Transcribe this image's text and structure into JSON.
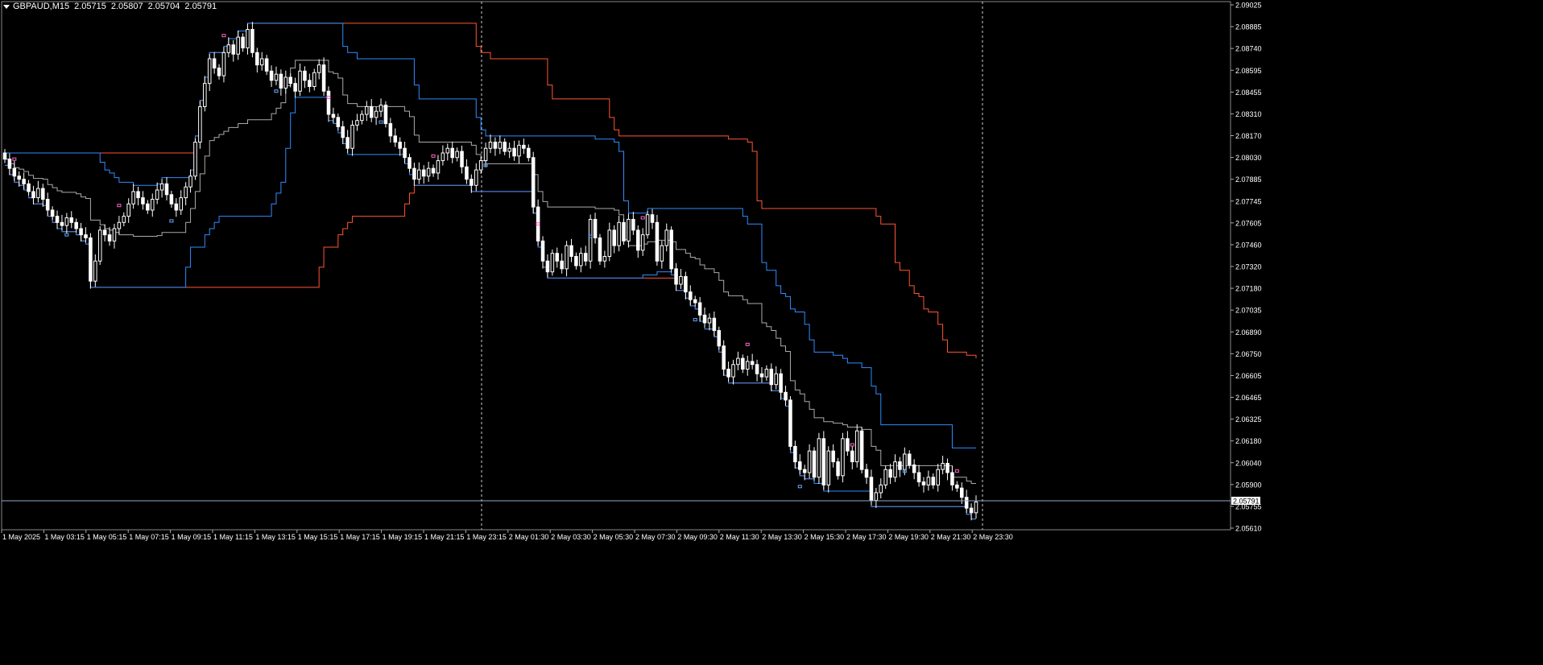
{
  "header": {
    "symbol": "GBPAUD,M15",
    "open": "2.05715",
    "high": "2.05807",
    "low": "2.05704",
    "close": "2.05791"
  },
  "current_price_label": "2.05791",
  "colors": {
    "background": "#000000",
    "candle": "#ffffff",
    "upper_band": "#ff5533",
    "middle_band": "#aaaaaa",
    "inner_band": "#2f8cff",
    "lower_band": "#ff5533",
    "marker_pink": "#ff66cc",
    "marker_blue": "#66aaff",
    "grid_vline": "#cccccc",
    "price_line": "#8fa8c8"
  },
  "y_axis_labels": [
    "2.09025",
    "2.08885",
    "2.08740",
    "2.08595",
    "2.08455",
    "2.08310",
    "2.08170",
    "2.08030",
    "2.07885",
    "2.07745",
    "2.07605",
    "2.07460",
    "2.07320",
    "2.07180",
    "2.07035",
    "2.06890",
    "2.06750",
    "2.06605",
    "2.06465",
    "2.06325",
    "2.06180",
    "2.06040",
    "2.05900",
    "2.05755",
    "2.05610"
  ],
  "x_axis_labels": [
    "1 May 2025",
    "1 May 03:15",
    "1 May 05:15",
    "1 May 07:15",
    "1 May 09:15",
    "1 May 11:15",
    "1 May 13:15",
    "1 May 15:15",
    "1 May 17:15",
    "1 May 19:15",
    "1 May 21:15",
    "1 May 23:15",
    "2 May 01:30",
    "2 May 03:30",
    "2 May 05:30",
    "2 May 07:30",
    "2 May 09:30",
    "2 May 11:30",
    "2 May 13:30",
    "2 May 15:30",
    "2 May 17:30",
    "2 May 19:30",
    "2 May 21:30",
    "2 May 23:30"
  ],
  "chart_data": {
    "type": "candlestick",
    "instrument": "GBPAUD",
    "timeframe": "M15",
    "ylim": [
      2.0561,
      2.0903
    ],
    "closes": [
      2.0801,
      2.0795,
      2.079,
      2.0788,
      2.0785,
      2.078,
      2.0776,
      2.0782,
      2.0775,
      2.0768,
      2.0764,
      2.076,
      2.0758,
      2.0763,
      2.076,
      2.0756,
      2.0752,
      2.075,
      2.0722,
      2.0735,
      2.0755,
      2.0752,
      2.0748,
      2.0756,
      2.076,
      2.0764,
      2.0772,
      2.078,
      2.0776,
      2.0772,
      2.0768,
      2.0775,
      2.0781,
      2.0785,
      2.0778,
      2.0772,
      2.0768,
      2.0776,
      2.0783,
      2.079,
      2.0812,
      2.0835,
      2.085,
      2.0866,
      2.086,
      2.0855,
      2.087,
      2.0875,
      2.0869,
      2.088,
      2.0873,
      2.0885,
      2.087,
      2.0862,
      2.0866,
      2.0858,
      2.0852,
      2.0856,
      2.0847,
      2.0854,
      2.085,
      2.0845,
      2.0858,
      2.0852,
      2.0848,
      2.0857,
      2.0862,
      2.0845,
      2.083,
      2.0828,
      2.0822,
      2.0815,
      2.0808,
      2.0823,
      2.0826,
      2.083,
      2.0835,
      2.0828,
      2.0832,
      2.0836,
      2.0824,
      2.0816,
      2.0812,
      2.0808,
      2.0802,
      2.0795,
      2.0788,
      2.0794,
      2.079,
      2.0795,
      2.0792,
      2.08,
      2.0805,
      2.0808,
      2.0802,
      2.0806,
      2.0796,
      2.0788,
      2.0784,
      2.0794,
      2.08,
      2.0808,
      2.0812,
      2.0808,
      2.0812,
      2.0806,
      2.0808,
      2.0803,
      2.081,
      2.0808,
      2.0802,
      2.077,
      2.0748,
      2.0735,
      2.0728,
      2.074,
      2.0735,
      2.073,
      2.0745,
      2.0738,
      2.0732,
      2.074,
      2.0735,
      2.0762,
      2.075,
      2.0735,
      2.0738,
      2.0755,
      2.0745,
      2.076,
      2.0748,
      2.0762,
      2.0755,
      2.0742,
      2.0752,
      2.0765,
      2.076,
      2.0735,
      2.0745,
      2.0755,
      2.073,
      2.072,
      2.0725,
      2.0715,
      2.071,
      2.0708,
      2.07,
      2.0695,
      2.0698,
      2.069,
      2.068,
      2.0665,
      2.066,
      2.0668,
      2.0672,
      2.0665,
      2.067,
      2.0668,
      2.0662,
      2.066,
      2.0665,
      2.0655,
      2.0662,
      2.065,
      2.0645,
      2.0615,
      2.0605,
      2.06,
      2.0598,
      2.0612,
      2.0595,
      2.062,
      2.059,
      2.0612,
      2.0605,
      2.0596,
      2.062,
      2.0612,
      2.0605,
      2.0625,
      2.06,
      2.0595,
      2.058,
      2.0585,
      2.059,
      2.06,
      2.0595,
      2.0605,
      2.06,
      2.061,
      2.0603,
      2.0598,
      2.0592,
      2.059,
      2.0595,
      2.059,
      2.06,
      2.0604,
      2.0598,
      2.059,
      2.0588,
      2.0582,
      2.0575,
      2.0572,
      2.0579
    ]
  }
}
